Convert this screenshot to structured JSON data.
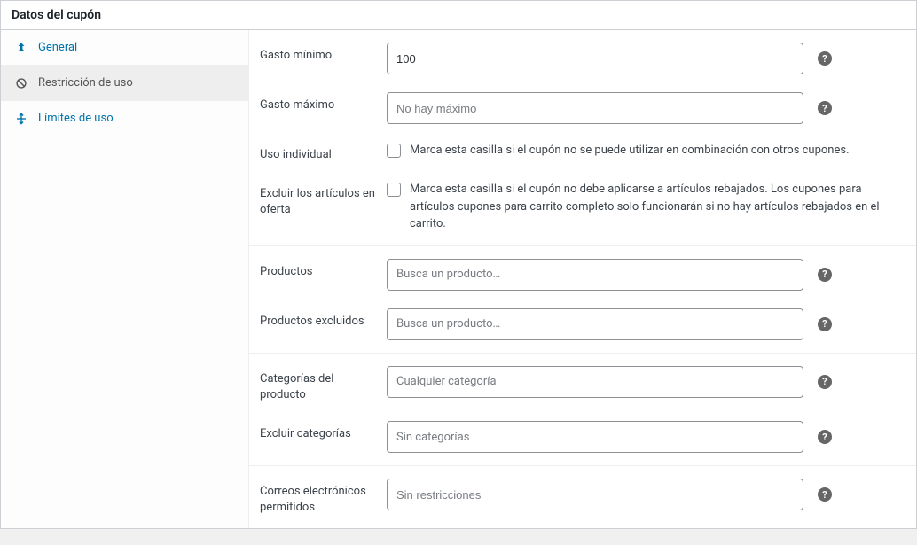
{
  "panel": {
    "title": "Datos del cupón"
  },
  "sidebar": {
    "items": [
      {
        "label": "General"
      },
      {
        "label": "Restricción de uso"
      },
      {
        "label": "Límites de uso"
      }
    ]
  },
  "fields": {
    "min_spend": {
      "label": "Gasto mínimo",
      "value": "100"
    },
    "max_spend": {
      "label": "Gasto máximo",
      "placeholder": "No hay máximo"
    },
    "individual_use": {
      "label": "Uso individual",
      "desc": "Marca esta casilla si el cupón no se puede utilizar en combinación con otros cupones."
    },
    "exclude_sale": {
      "label": "Excluir los artículos en oferta",
      "desc": "Marca esta casilla si el cupón no debe aplicarse a artículos rebajados. Los cupones para artículos cupones para carrito completo solo funcionarán si no hay artículos rebajados en el carrito."
    },
    "products": {
      "label": "Productos",
      "placeholder": "Busca un producto…"
    },
    "excluded_products": {
      "label": "Productos excluidos",
      "placeholder": "Busca un producto…"
    },
    "categories": {
      "label": "Categorías del producto",
      "placeholder": "Cualquier categoría"
    },
    "excluded_categories": {
      "label": "Excluir categorías",
      "placeholder": "Sin categorías"
    },
    "emails": {
      "label": "Correos electrónicos permitidos",
      "placeholder": "Sin restricciones"
    }
  }
}
